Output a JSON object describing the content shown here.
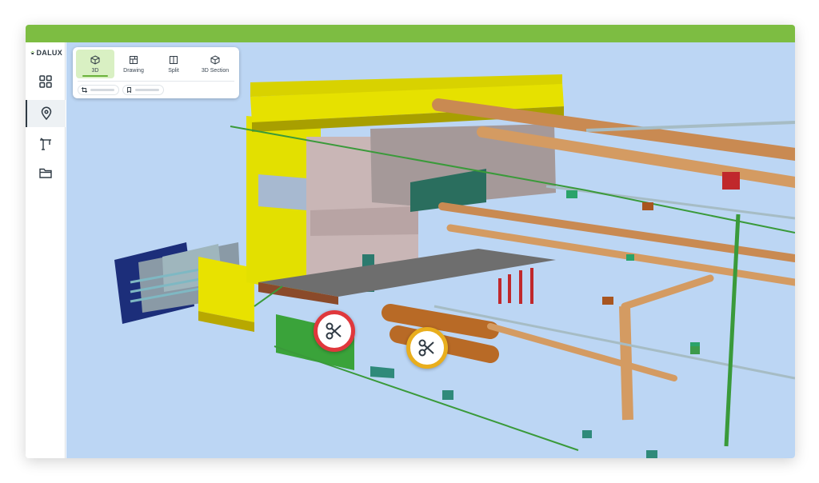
{
  "app": {
    "logo_text": "DALUX",
    "brand_color": "#7dbd42"
  },
  "sidebar": {
    "items": [
      {
        "icon": "grid-icon",
        "active": false
      },
      {
        "icon": "map-pin-icon",
        "active": true
      },
      {
        "icon": "crane-icon",
        "active": false
      },
      {
        "icon": "folder-icon",
        "active": false
      }
    ]
  },
  "toolbar": {
    "tabs": [
      {
        "label": "3D",
        "icon": "cube-icon",
        "active": true
      },
      {
        "label": "Drawing",
        "icon": "drawing-icon",
        "active": false
      },
      {
        "label": "Split",
        "icon": "split-icon",
        "active": false
      },
      {
        "label": "3D Section",
        "icon": "section-cube-icon",
        "active": false
      }
    ],
    "chips": [
      {
        "icon": "crop-icon"
      },
      {
        "icon": "bookmark-icon"
      }
    ]
  },
  "viewport": {
    "background": "#bcd6f4",
    "clash_markers": [
      {
        "icon": "scissors-icon",
        "color": "#e0383c"
      },
      {
        "icon": "scissors-icon",
        "color": "#e9ae1d"
      }
    ]
  }
}
